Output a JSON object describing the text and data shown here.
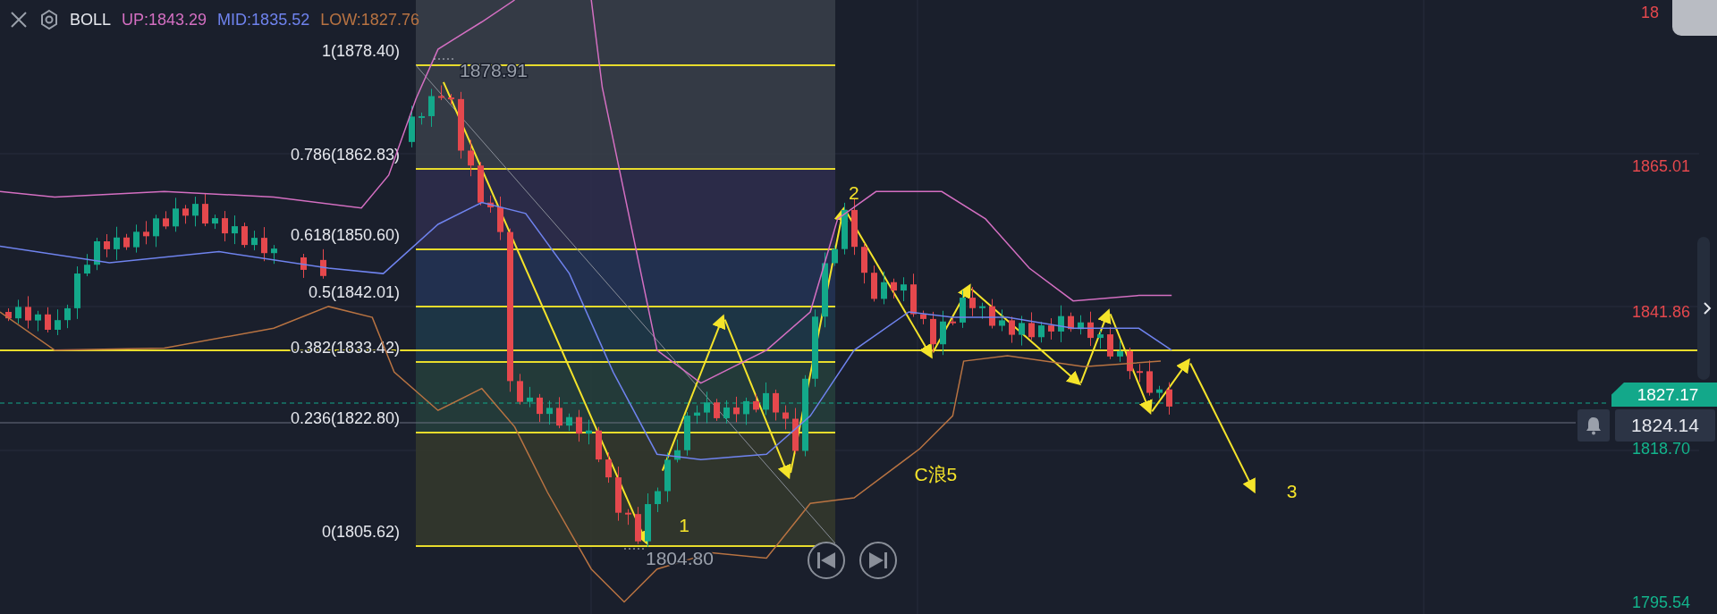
{
  "indicator": {
    "name": "BOLL",
    "up": "UP:1843.29",
    "mid": "MID:1835.52",
    "low": "LOW:1827.76"
  },
  "fib_levels": [
    {
      "label": "1(1878.40)"
    },
    {
      "label": "0.786(1862.83)"
    },
    {
      "label": "0.618(1850.60)"
    },
    {
      "label": "0.5(1842.01)"
    },
    {
      "label": "0.382(1833.42)"
    },
    {
      "label": "0.236(1822.80)"
    },
    {
      "label": "0(1805.62)"
    }
  ],
  "extremes": {
    "high": "1878.91",
    "low": "1804.80"
  },
  "wave_labels": [
    {
      "text": "1"
    },
    {
      "text": "2"
    },
    {
      "text": "C浪5"
    },
    {
      "text": "3"
    }
  ],
  "price_axis": [
    {
      "label": "18",
      "color": "#e5484d"
    },
    {
      "label": "1865.01",
      "color": "#e5484d"
    },
    {
      "label": "1841.86",
      "color": "#e5484d"
    },
    {
      "label": "1818.70",
      "color": "#13b48c"
    },
    {
      "label": "1795.54",
      "color": "#13b48c"
    }
  ],
  "current_price": "1827.17",
  "alert_price": "1824.14"
}
